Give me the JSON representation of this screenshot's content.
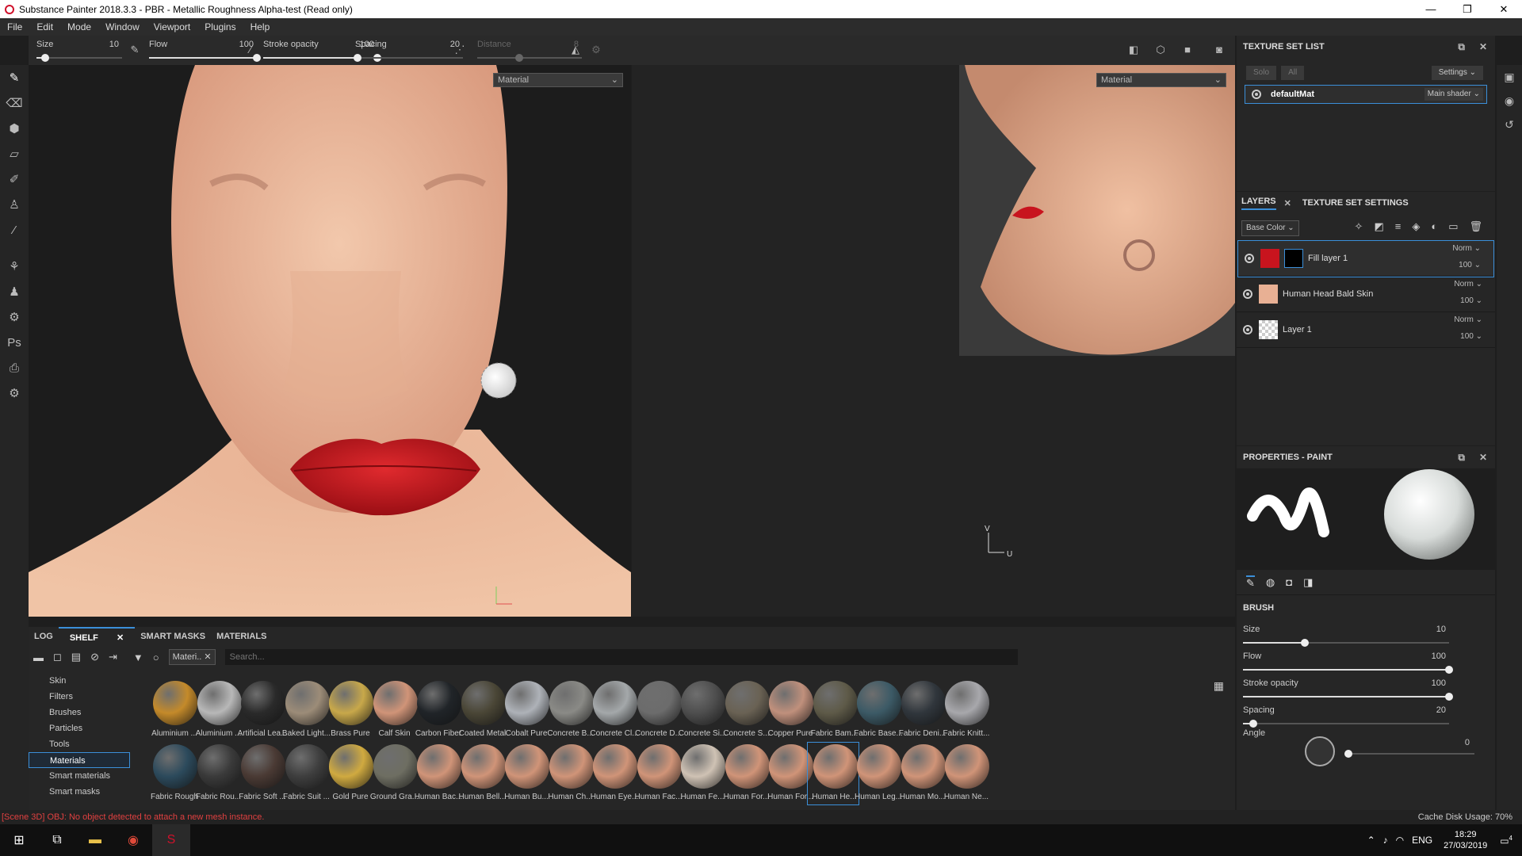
{
  "window": {
    "title": "Substance Painter 2018.3.3 - PBR - Metallic Roughness Alpha-test (Read only)",
    "controls": [
      "—",
      "❐",
      "✕"
    ]
  },
  "menu": [
    "File",
    "Edit",
    "Mode",
    "Window",
    "Viewport",
    "Plugins",
    "Help"
  ],
  "toolbar": {
    "size": {
      "label": "Size",
      "value": "10",
      "fraction": 0.1
    },
    "flow": {
      "label": "Flow",
      "value": "100",
      "fraction": 1.0
    },
    "stroke_opacity": {
      "label": "Stroke opacity",
      "value": "100",
      "fraction": 1.0
    },
    "spacing": {
      "label": "Spacing",
      "value": "20",
      "fraction": 0.02
    },
    "distance": {
      "label": "Distance",
      "value": "8",
      "fraction": 0.4
    }
  },
  "viewport3d": {
    "dropdown": "Material"
  },
  "viewport2d": {
    "dropdown": "Material",
    "axis_v": "V",
    "axis_u": "U"
  },
  "texture_set_list": {
    "title": "TEXTURE SET LIST",
    "solo": "Solo",
    "all": "All",
    "settings": "Settings",
    "set_name": "defaultMat",
    "shader": "Main shader"
  },
  "layers": {
    "tab_layers": "LAYERS",
    "tab_texture_settings": "TEXTURE SET SETTINGS",
    "channel": "Base Color",
    "items": [
      {
        "name": "Fill layer 1",
        "blend": "Norm",
        "opacity": "100"
      },
      {
        "name": "Human Head Bald Skin",
        "blend": "Norm",
        "opacity": "100"
      },
      {
        "name": "Layer 1",
        "blend": "Norm",
        "opacity": "100"
      }
    ]
  },
  "properties": {
    "title": "PROPERTIES - PAINT",
    "section": "BRUSH",
    "size": {
      "label": "Size",
      "value": "10",
      "fraction": 0.3
    },
    "flow": {
      "label": "Flow",
      "value": "100",
      "fraction": 1.0
    },
    "stroke_opacity": {
      "label": "Stroke opacity",
      "value": "100",
      "fraction": 1.0
    },
    "spacing": {
      "label": "Spacing",
      "value": "20",
      "fraction": 0.05
    },
    "angle": {
      "label": "Angle",
      "value": "0",
      "fraction": 0.0
    }
  },
  "bottom": {
    "tabs": [
      "LOG",
      "SHELF",
      "SMART MASKS",
      "MATERIALS"
    ],
    "active_tab": "SHELF",
    "filter_chip": "Materi..",
    "search_placeholder": "Search...",
    "categories": [
      "Skin",
      "Filters",
      "Brushes",
      "Particles",
      "Tools",
      "Materials",
      "Smart materials",
      "Smart masks"
    ],
    "selected_category": "Materials",
    "materials_row1": [
      {
        "name": "Aluminium ...",
        "color": "#c48a2a"
      },
      {
        "name": "Aluminium ...",
        "color": "#b8b8b8"
      },
      {
        "name": "Artificial Lea...",
        "color": "#2a2a2a"
      },
      {
        "name": "Baked Light...",
        "color": "#9c8c78"
      },
      {
        "name": "Brass Pure",
        "color": "#c8a84a"
      },
      {
        "name": "Calf Skin",
        "color": "#d09478"
      },
      {
        "name": "Carbon Fiber",
        "color": "#202428"
      },
      {
        "name": "Coated Metal",
        "color": "#4a4636"
      },
      {
        "name": "Cobalt Pure",
        "color": "#aeb2b8"
      },
      {
        "name": "Concrete B...",
        "color": "#8a8a86"
      },
      {
        "name": "Concrete Cl...",
        "color": "#a4a8aa"
      },
      {
        "name": "Concrete D...",
        "color": "#6c6c6c"
      },
      {
        "name": "Concrete Si...",
        "color": "#4e4e4e"
      },
      {
        "name": "Concrete S...",
        "color": "#6a6254"
      },
      {
        "name": "Copper Pure",
        "color": "#c0907c"
      },
      {
        "name": "Fabric Bam...",
        "color": "#5e5a48"
      },
      {
        "name": "Fabric Base...",
        "color": "#3c5a66"
      },
      {
        "name": "Fabric Deni...",
        "color": "#30363c"
      },
      {
        "name": "Fabric Knitt...",
        "color": "#a8a8ac"
      }
    ],
    "materials_row2": [
      {
        "name": "Fabric Rough",
        "color": "#2c4a5c"
      },
      {
        "name": "Fabric Rou...",
        "color": "#3a3a3a"
      },
      {
        "name": "Fabric Soft ...",
        "color": "#4a3a34"
      },
      {
        "name": "Fabric Suit ...",
        "color": "#3e3e3e"
      },
      {
        "name": "Gold Pure",
        "color": "#d0aa40"
      },
      {
        "name": "Ground Gra...",
        "color": "#6e6e62"
      },
      {
        "name": "Human Bac...",
        "color": "#d09478"
      },
      {
        "name": "Human Bell...",
        "color": "#d09478"
      },
      {
        "name": "Human Bu...",
        "color": "#d09478"
      },
      {
        "name": "Human Ch...",
        "color": "#d09478"
      },
      {
        "name": "Human Eye...",
        "color": "#d09478"
      },
      {
        "name": "Human Fac...",
        "color": "#d09478"
      },
      {
        "name": "Human Fe...",
        "color": "#cfc2b4"
      },
      {
        "name": "Human For...",
        "color": "#d09478"
      },
      {
        "name": "Human For...",
        "color": "#d09478"
      },
      {
        "name": "Human He...",
        "color": "#d09478"
      },
      {
        "name": "Human Leg...",
        "color": "#d09478"
      },
      {
        "name": "Human Mo...",
        "color": "#d09478"
      },
      {
        "name": "Human Ne...",
        "color": "#d09478"
      }
    ],
    "selected_material_index": 15
  },
  "status": {
    "message": "[Scene 3D] OBJ: No object detected to attach a new mesh instance.",
    "cache": "Cache Disk Usage:",
    "cache_value": "70%"
  },
  "taskbar": {
    "lang": "ENG",
    "time": "18:29",
    "date": "27/03/2019",
    "notif": "4"
  },
  "colors": {
    "accent": "#3b8fd9",
    "skin": "#e8b89a",
    "lips": "#c8141e",
    "error": "#e04040"
  }
}
